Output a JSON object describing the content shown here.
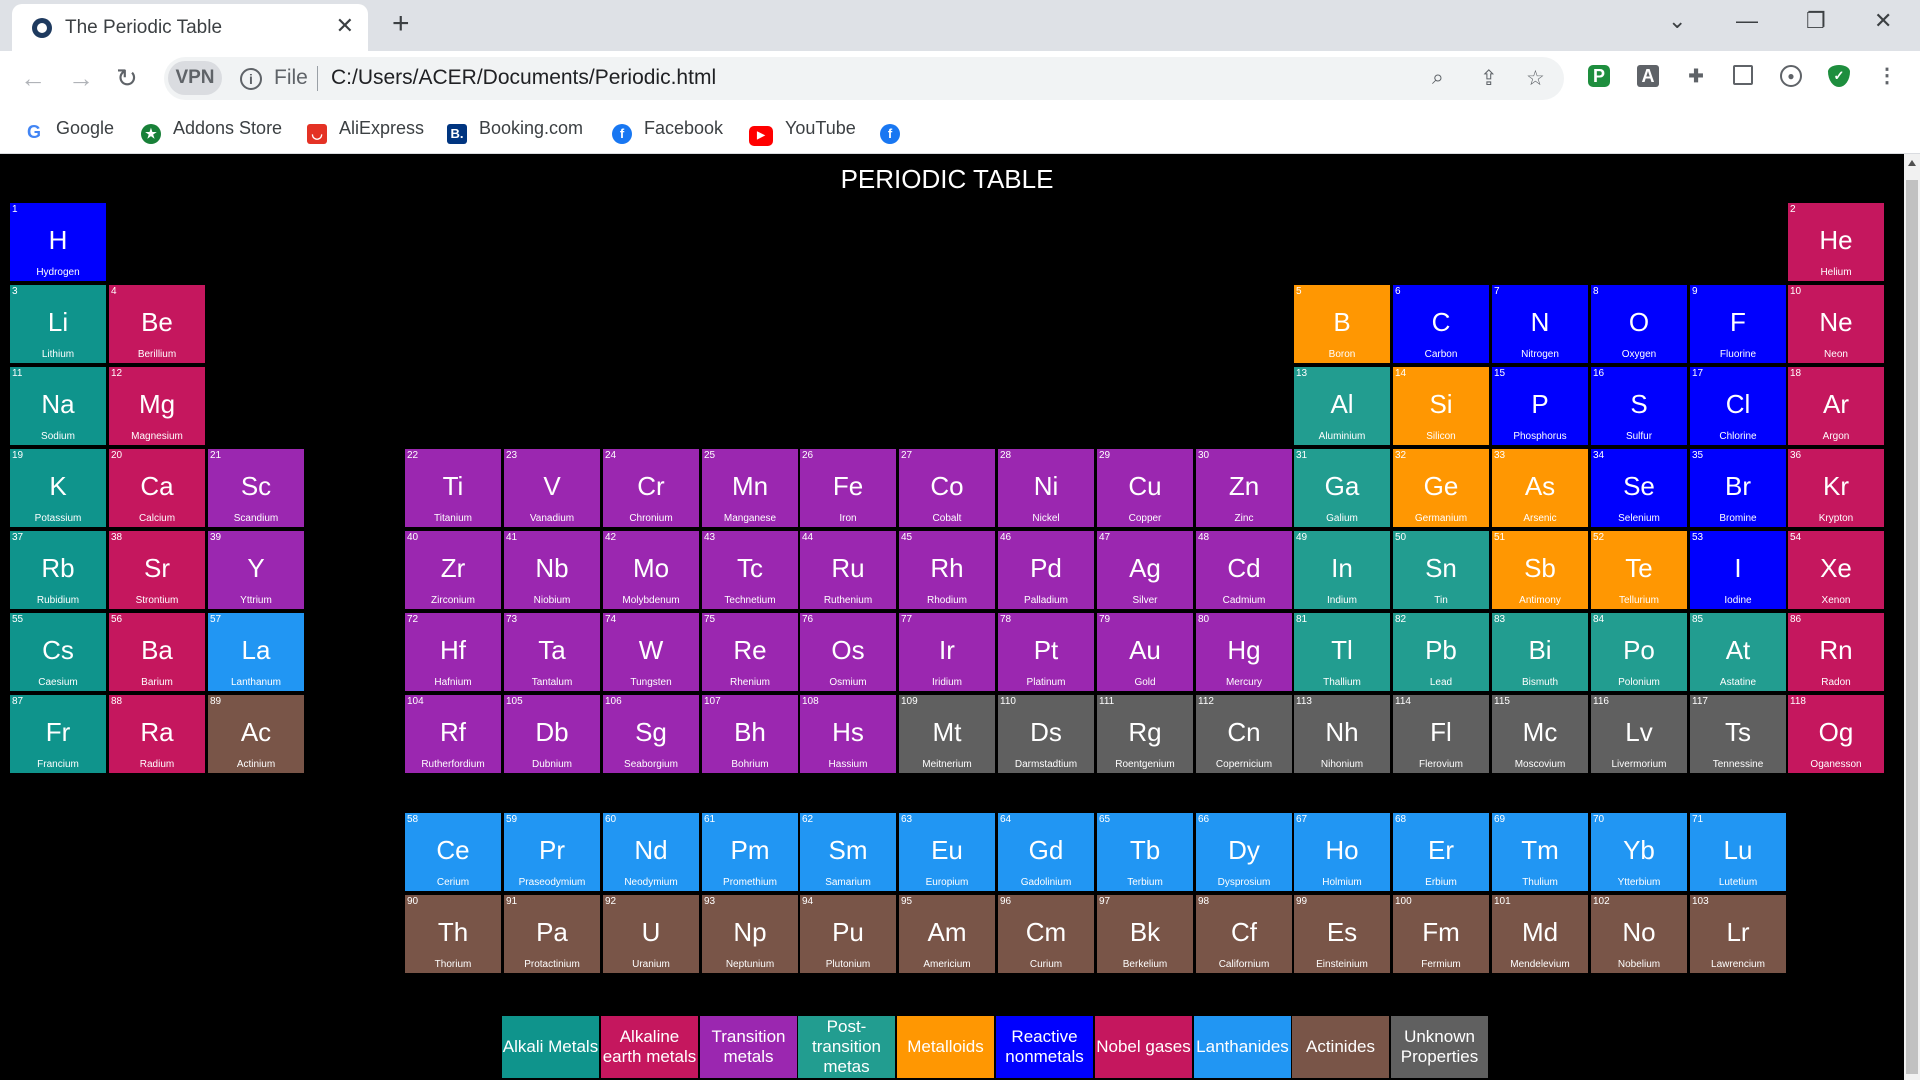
{
  "browser": {
    "tab_title": "The Periodic Table",
    "tab_close": "✕",
    "new_tab": "+",
    "vpn_label": "VPN",
    "file_label": "File",
    "url": "C:/Users/ACER/Documents/Periodic.html",
    "bookmarks": [
      {
        "label": "Google",
        "icon": "google-icon",
        "color": "#4285f4"
      },
      {
        "label": "Addons Store",
        "icon": "addons-store-icon",
        "color": "#188038"
      },
      {
        "label": "AliExpress",
        "icon": "aliexpress-icon",
        "color": "#e43225"
      },
      {
        "label": "Booking.com",
        "icon": "booking-icon",
        "color": "#003580"
      },
      {
        "label": "Facebook",
        "icon": "facebook-icon",
        "color": "#1877f2"
      },
      {
        "label": "YouTube",
        "icon": "youtube-icon",
        "color": "#ff0000"
      },
      {
        "label": "",
        "icon": "facebook-icon",
        "color": "#1877f2"
      }
    ]
  },
  "page": {
    "title": "PERIODIC TABLE"
  },
  "colors": {
    "alkali": "#0f948c",
    "alkaline": "#c5175e",
    "transition": "#9b27b0",
    "post": "#229d90",
    "metalloid": "#ff9702",
    "reactive": "#0000fe",
    "noble": "#c5175e",
    "lanthanide": "#2196f3",
    "actinide": "#795548",
    "unknown": "#606060"
  },
  "elements": [
    {
      "n": "1",
      "s": "H",
      "name": "Hydrogen",
      "cat": "reactive",
      "row": 1,
      "col": 1
    },
    {
      "n": "2",
      "s": "He",
      "name": "Helium",
      "cat": "noble",
      "row": 1,
      "col": 19
    },
    {
      "n": "3",
      "s": "Li",
      "name": "Lithium",
      "cat": "alkali",
      "row": 2,
      "col": 1
    },
    {
      "n": "4",
      "s": "Be",
      "name": "Berillium",
      "cat": "alkaline",
      "row": 2,
      "col": 2
    },
    {
      "n": "5",
      "s": "B",
      "name": "Boron",
      "cat": "metalloid",
      "row": 2,
      "col": 14
    },
    {
      "n": "6",
      "s": "C",
      "name": "Carbon",
      "cat": "reactive",
      "row": 2,
      "col": 15
    },
    {
      "n": "7",
      "s": "N",
      "name": "Nitrogen",
      "cat": "reactive",
      "row": 2,
      "col": 16
    },
    {
      "n": "8",
      "s": "O",
      "name": "Oxygen",
      "cat": "reactive",
      "row": 2,
      "col": 17
    },
    {
      "n": "9",
      "s": "F",
      "name": "Fluorine",
      "cat": "reactive",
      "row": 2,
      "col": 18
    },
    {
      "n": "10",
      "s": "Ne",
      "name": "Neon",
      "cat": "noble",
      "row": 2,
      "col": 19
    },
    {
      "n": "11",
      "s": "Na",
      "name": "Sodium",
      "cat": "alkali",
      "row": 3,
      "col": 1
    },
    {
      "n": "12",
      "s": "Mg",
      "name": "Magnesium",
      "cat": "alkaline",
      "row": 3,
      "col": 2
    },
    {
      "n": "13",
      "s": "Al",
      "name": "Aluminium",
      "cat": "post",
      "row": 3,
      "col": 14
    },
    {
      "n": "14",
      "s": "Si",
      "name": "Silicon",
      "cat": "metalloid",
      "row": 3,
      "col": 15
    },
    {
      "n": "15",
      "s": "P",
      "name": "Phosphorus",
      "cat": "reactive",
      "row": 3,
      "col": 16
    },
    {
      "n": "16",
      "s": "S",
      "name": "Sulfur",
      "cat": "reactive",
      "row": 3,
      "col": 17
    },
    {
      "n": "17",
      "s": "Cl",
      "name": "Chlorine",
      "cat": "reactive",
      "row": 3,
      "col": 18
    },
    {
      "n": "18",
      "s": "Ar",
      "name": "Argon",
      "cat": "noble",
      "row": 3,
      "col": 19
    },
    {
      "n": "19",
      "s": "K",
      "name": "Potassium",
      "cat": "alkali",
      "row": 4,
      "col": 1
    },
    {
      "n": "20",
      "s": "Ca",
      "name": "Calcium",
      "cat": "alkaline",
      "row": 4,
      "col": 2
    },
    {
      "n": "21",
      "s": "Sc",
      "name": "Scandium",
      "cat": "transition",
      "row": 4,
      "col": 3
    },
    {
      "n": "22",
      "s": "Ti",
      "name": "Titanium",
      "cat": "transition",
      "row": 4,
      "col": 5
    },
    {
      "n": "23",
      "s": "V",
      "name": "Vanadium",
      "cat": "transition",
      "row": 4,
      "col": 6
    },
    {
      "n": "24",
      "s": "Cr",
      "name": "Chronium",
      "cat": "transition",
      "row": 4,
      "col": 7
    },
    {
      "n": "25",
      "s": "Mn",
      "name": "Manganese",
      "cat": "transition",
      "row": 4,
      "col": 8
    },
    {
      "n": "26",
      "s": "Fe",
      "name": "Iron",
      "cat": "transition",
      "row": 4,
      "col": 9
    },
    {
      "n": "27",
      "s": "Co",
      "name": "Cobalt",
      "cat": "transition",
      "row": 4,
      "col": 10
    },
    {
      "n": "28",
      "s": "Ni",
      "name": "Nickel",
      "cat": "transition",
      "row": 4,
      "col": 11
    },
    {
      "n": "29",
      "s": "Cu",
      "name": "Copper",
      "cat": "transition",
      "row": 4,
      "col": 12
    },
    {
      "n": "30",
      "s": "Zn",
      "name": "Zinc",
      "cat": "transition",
      "row": 4,
      "col": 13
    },
    {
      "n": "31",
      "s": "Ga",
      "name": "Galium",
      "cat": "post",
      "row": 4,
      "col": 14
    },
    {
      "n": "32",
      "s": "Ge",
      "name": "Germanium",
      "cat": "metalloid",
      "row": 4,
      "col": 15
    },
    {
      "n": "33",
      "s": "As",
      "name": "Arsenic",
      "cat": "metalloid",
      "row": 4,
      "col": 16
    },
    {
      "n": "34",
      "s": "Se",
      "name": "Selenium",
      "cat": "reactive",
      "row": 4,
      "col": 17
    },
    {
      "n": "35",
      "s": "Br",
      "name": "Bromine",
      "cat": "reactive",
      "row": 4,
      "col": 18
    },
    {
      "n": "36",
      "s": "Kr",
      "name": "Krypton",
      "cat": "noble",
      "row": 4,
      "col": 19
    },
    {
      "n": "37",
      "s": "Rb",
      "name": "Rubidium",
      "cat": "alkali",
      "row": 5,
      "col": 1
    },
    {
      "n": "38",
      "s": "Sr",
      "name": "Strontium",
      "cat": "alkaline",
      "row": 5,
      "col": 2
    },
    {
      "n": "39",
      "s": "Y",
      "name": "Yttrium",
      "cat": "transition",
      "row": 5,
      "col": 3
    },
    {
      "n": "40",
      "s": "Zr",
      "name": "Zirconium",
      "cat": "transition",
      "row": 5,
      "col": 5
    },
    {
      "n": "41",
      "s": "Nb",
      "name": "Niobium",
      "cat": "transition",
      "row": 5,
      "col": 6
    },
    {
      "n": "42",
      "s": "Mo",
      "name": "Molybdenum",
      "cat": "transition",
      "row": 5,
      "col": 7
    },
    {
      "n": "43",
      "s": "Tc",
      "name": "Technetium",
      "cat": "transition",
      "row": 5,
      "col": 8
    },
    {
      "n": "44",
      "s": "Ru",
      "name": "Ruthenium",
      "cat": "transition",
      "row": 5,
      "col": 9
    },
    {
      "n": "45",
      "s": "Rh",
      "name": "Rhodium",
      "cat": "transition",
      "row": 5,
      "col": 10
    },
    {
      "n": "46",
      "s": "Pd",
      "name": "Palladium",
      "cat": "transition",
      "row": 5,
      "col": 11
    },
    {
      "n": "47",
      "s": "Ag",
      "name": "Silver",
      "cat": "transition",
      "row": 5,
      "col": 12
    },
    {
      "n": "48",
      "s": "Cd",
      "name": "Cadmium",
      "cat": "transition",
      "row": 5,
      "col": 13
    },
    {
      "n": "49",
      "s": "In",
      "name": "Indium",
      "cat": "post",
      "row": 5,
      "col": 14
    },
    {
      "n": "50",
      "s": "Sn",
      "name": "Tin",
      "cat": "post",
      "row": 5,
      "col": 15
    },
    {
      "n": "51",
      "s": "Sb",
      "name": "Antimony",
      "cat": "metalloid",
      "row": 5,
      "col": 16
    },
    {
      "n": "52",
      "s": "Te",
      "name": "Tellurium",
      "cat": "metalloid",
      "row": 5,
      "col": 17
    },
    {
      "n": "53",
      "s": "I",
      "name": "Iodine",
      "cat": "reactive",
      "row": 5,
      "col": 18
    },
    {
      "n": "54",
      "s": "Xe",
      "name": "Xenon",
      "cat": "noble",
      "row": 5,
      "col": 19
    },
    {
      "n": "55",
      "s": "Cs",
      "name": "Caesium",
      "cat": "alkali",
      "row": 6,
      "col": 1
    },
    {
      "n": "56",
      "s": "Ba",
      "name": "Barium",
      "cat": "alkaline",
      "row": 6,
      "col": 2
    },
    {
      "n": "57",
      "s": "La",
      "name": "Lanthanum",
      "cat": "lanthanide",
      "row": 6,
      "col": 3
    },
    {
      "n": "72",
      "s": "Hf",
      "name": "Hafnium",
      "cat": "transition",
      "row": 6,
      "col": 5
    },
    {
      "n": "73",
      "s": "Ta",
      "name": "Tantalum",
      "cat": "transition",
      "row": 6,
      "col": 6
    },
    {
      "n": "74",
      "s": "W",
      "name": "Tungsten",
      "cat": "transition",
      "row": 6,
      "col": 7
    },
    {
      "n": "75",
      "s": "Re",
      "name": "Rhenium",
      "cat": "transition",
      "row": 6,
      "col": 8
    },
    {
      "n": "76",
      "s": "Os",
      "name": "Osmium",
      "cat": "transition",
      "row": 6,
      "col": 9
    },
    {
      "n": "77",
      "s": "Ir",
      "name": "Iridium",
      "cat": "transition",
      "row": 6,
      "col": 10
    },
    {
      "n": "78",
      "s": "Pt",
      "name": "Platinum",
      "cat": "transition",
      "row": 6,
      "col": 11
    },
    {
      "n": "79",
      "s": "Au",
      "name": "Gold",
      "cat": "transition",
      "row": 6,
      "col": 12
    },
    {
      "n": "80",
      "s": "Hg",
      "name": "Mercury",
      "cat": "transition",
      "row": 6,
      "col": 13
    },
    {
      "n": "81",
      "s": "Tl",
      "name": "Thallium",
      "cat": "post",
      "row": 6,
      "col": 14
    },
    {
      "n": "82",
      "s": "Pb",
      "name": "Lead",
      "cat": "post",
      "row": 6,
      "col": 15
    },
    {
      "n": "83",
      "s": "Bi",
      "name": "Bismuth",
      "cat": "post",
      "row": 6,
      "col": 16
    },
    {
      "n": "84",
      "s": "Po",
      "name": "Polonium",
      "cat": "post",
      "row": 6,
      "col": 17
    },
    {
      "n": "85",
      "s": "At",
      "name": "Astatine",
      "cat": "post",
      "row": 6,
      "col": 18
    },
    {
      "n": "86",
      "s": "Rn",
      "name": "Radon",
      "cat": "noble",
      "row": 6,
      "col": 19
    },
    {
      "n": "87",
      "s": "Fr",
      "name": "Francium",
      "cat": "alkali",
      "row": 7,
      "col": 1
    },
    {
      "n": "88",
      "s": "Ra",
      "name": "Radium",
      "cat": "alkaline",
      "row": 7,
      "col": 2
    },
    {
      "n": "89",
      "s": "Ac",
      "name": "Actinium",
      "cat": "actinide",
      "row": 7,
      "col": 3
    },
    {
      "n": "104",
      "s": "Rf",
      "name": "Rutherfordium",
      "cat": "transition",
      "row": 7,
      "col": 5
    },
    {
      "n": "105",
      "s": "Db",
      "name": "Dubnium",
      "cat": "transition",
      "row": 7,
      "col": 6
    },
    {
      "n": "106",
      "s": "Sg",
      "name": "Seaborgium",
      "cat": "transition",
      "row": 7,
      "col": 7
    },
    {
      "n": "107",
      "s": "Bh",
      "name": "Bohrium",
      "cat": "transition",
      "row": 7,
      "col": 8
    },
    {
      "n": "108",
      "s": "Hs",
      "name": "Hassium",
      "cat": "transition",
      "row": 7,
      "col": 9
    },
    {
      "n": "109",
      "s": "Mt",
      "name": "Meitnerium",
      "cat": "unknown",
      "row": 7,
      "col": 10
    },
    {
      "n": "110",
      "s": "Ds",
      "name": "Darmstadtium",
      "cat": "unknown",
      "row": 7,
      "col": 11
    },
    {
      "n": "111",
      "s": "Rg",
      "name": "Roentgenium",
      "cat": "unknown",
      "row": 7,
      "col": 12
    },
    {
      "n": "112",
      "s": "Cn",
      "name": "Copernicium",
      "cat": "unknown",
      "row": 7,
      "col": 13
    },
    {
      "n": "113",
      "s": "Nh",
      "name": "Nihonium",
      "cat": "unknown",
      "row": 7,
      "col": 14
    },
    {
      "n": "114",
      "s": "Fl",
      "name": "Flerovium",
      "cat": "unknown",
      "row": 7,
      "col": 15
    },
    {
      "n": "115",
      "s": "Mc",
      "name": "Moscovium",
      "cat": "unknown",
      "row": 7,
      "col": 16
    },
    {
      "n": "116",
      "s": "Lv",
      "name": "Livermorium",
      "cat": "unknown",
      "row": 7,
      "col": 17
    },
    {
      "n": "117",
      "s": "Ts",
      "name": "Tennessine",
      "cat": "unknown",
      "row": 7,
      "col": 18
    },
    {
      "n": "118",
      "s": "Og",
      "name": "Oganesson",
      "cat": "noble",
      "row": 7,
      "col": 19
    },
    {
      "n": "58",
      "s": "Ce",
      "name": "Cerium",
      "cat": "lanthanide",
      "row": 8,
      "col": 5
    },
    {
      "n": "59",
      "s": "Pr",
      "name": "Praseodymium",
      "cat": "lanthanide",
      "row": 8,
      "col": 6
    },
    {
      "n": "60",
      "s": "Nd",
      "name": "Neodymium",
      "cat": "lanthanide",
      "row": 8,
      "col": 7
    },
    {
      "n": "61",
      "s": "Pm",
      "name": "Promethium",
      "cat": "lanthanide",
      "row": 8,
      "col": 8
    },
    {
      "n": "62",
      "s": "Sm",
      "name": "Samarium",
      "cat": "lanthanide",
      "row": 8,
      "col": 9
    },
    {
      "n": "63",
      "s": "Eu",
      "name": "Europium",
      "cat": "lanthanide",
      "row": 8,
      "col": 10
    },
    {
      "n": "64",
      "s": "Gd",
      "name": "Gadolinium",
      "cat": "lanthanide",
      "row": 8,
      "col": 11
    },
    {
      "n": "65",
      "s": "Tb",
      "name": "Terbium",
      "cat": "lanthanide",
      "row": 8,
      "col": 12
    },
    {
      "n": "66",
      "s": "Dy",
      "name": "Dysprosium",
      "cat": "lanthanide",
      "row": 8,
      "col": 13
    },
    {
      "n": "67",
      "s": "Ho",
      "name": "Holmium",
      "cat": "lanthanide",
      "row": 8,
      "col": 14
    },
    {
      "n": "68",
      "s": "Er",
      "name": "Erbium",
      "cat": "lanthanide",
      "row": 8,
      "col": 15
    },
    {
      "n": "69",
      "s": "Tm",
      "name": "Thulium",
      "cat": "lanthanide",
      "row": 8,
      "col": 16
    },
    {
      "n": "70",
      "s": "Yb",
      "name": "Ytterbium",
      "cat": "lanthanide",
      "row": 8,
      "col": 17
    },
    {
      "n": "71",
      "s": "Lu",
      "name": "Lutetium",
      "cat": "lanthanide",
      "row": 8,
      "col": 18
    },
    {
      "n": "90",
      "s": "Th",
      "name": "Thorium",
      "cat": "actinide",
      "row": 9,
      "col": 5
    },
    {
      "n": "91",
      "s": "Pa",
      "name": "Protactinium",
      "cat": "actinide",
      "row": 9,
      "col": 6
    },
    {
      "n": "92",
      "s": "U",
      "name": "Uranium",
      "cat": "actinide",
      "row": 9,
      "col": 7
    },
    {
      "n": "93",
      "s": "Np",
      "name": "Neptunium",
      "cat": "actinide",
      "row": 9,
      "col": 8
    },
    {
      "n": "94",
      "s": "Pu",
      "name": "Plutonium",
      "cat": "actinide",
      "row": 9,
      "col": 9
    },
    {
      "n": "95",
      "s": "Am",
      "name": "Americium",
      "cat": "actinide",
      "row": 9,
      "col": 10
    },
    {
      "n": "96",
      "s": "Cm",
      "name": "Curium",
      "cat": "actinide",
      "row": 9,
      "col": 11
    },
    {
      "n": "97",
      "s": "Bk",
      "name": "Berkelium",
      "cat": "actinide",
      "row": 9,
      "col": 12
    },
    {
      "n": "98",
      "s": "Cf",
      "name": "Californium",
      "cat": "actinide",
      "row": 9,
      "col": 13
    },
    {
      "n": "99",
      "s": "Es",
      "name": "Einsteinium",
      "cat": "actinide",
      "row": 9,
      "col": 14
    },
    {
      "n": "100",
      "s": "Fm",
      "name": "Fermium",
      "cat": "actinide",
      "row": 9,
      "col": 15
    },
    {
      "n": "101",
      "s": "Md",
      "name": "Mendelevium",
      "cat": "actinide",
      "row": 9,
      "col": 16
    },
    {
      "n": "102",
      "s": "No",
      "name": "Nobelium",
      "cat": "actinide",
      "row": 9,
      "col": 17
    },
    {
      "n": "103",
      "s": "Lr",
      "name": "Lawrencium",
      "cat": "actinide",
      "row": 9,
      "col": 18
    }
  ],
  "legend": [
    {
      "label": "Alkali Metals",
      "cat": "alkali"
    },
    {
      "label": "Alkaline earth metals",
      "cat": "alkaline"
    },
    {
      "label": "Transition metals",
      "cat": "transition"
    },
    {
      "label": "Post-transition metas",
      "cat": "post"
    },
    {
      "label": "Metalloids",
      "cat": "metalloid"
    },
    {
      "label": "Reactive nonmetals",
      "cat": "reactive"
    },
    {
      "label": "Nobel gases",
      "cat": "noble"
    },
    {
      "label": "Lanthanides",
      "cat": "lanthanide"
    },
    {
      "label": "Actinides",
      "cat": "actinide"
    },
    {
      "label": "Unknown Properties",
      "cat": "unknown"
    }
  ]
}
